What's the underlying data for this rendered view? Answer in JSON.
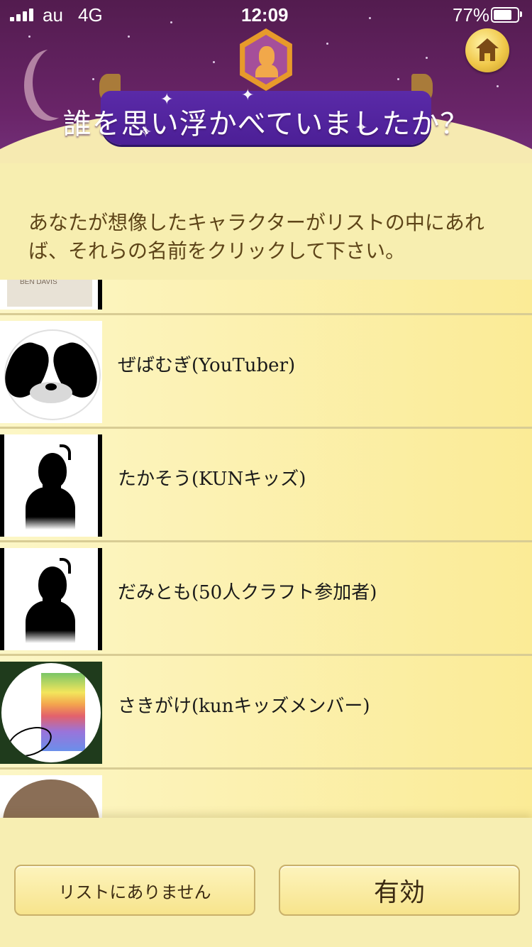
{
  "status_bar": {
    "carrier": "au",
    "network": "4G",
    "time": "12:09",
    "battery_percent": "77%",
    "battery_level": 0.77
  },
  "header": {
    "title": "誰を思い浮かべていましたか？",
    "home_icon": "home-icon",
    "badge_icon": "character-portrait-badge-icon"
  },
  "instructions": "あなたが想像したキャラクターがリストの中にあれば、それらの名前をクリックして下さい。",
  "list": {
    "items": [
      {
        "label": "",
        "thumbnail": "person-photo-shirt"
      },
      {
        "label": "ぜばむぎ(YouTuber)",
        "thumbnail": "panda-avatar"
      },
      {
        "label": "たかそう(KUNキッズ)",
        "thumbnail": "silhouette"
      },
      {
        "label": "だみとも(50人クラフト参加者)",
        "thumbnail": "silhouette"
      },
      {
        "label": "さきがけ(kunキッズメンバー)",
        "thumbnail": "rainbow-figure"
      },
      {
        "label": "",
        "thumbnail": "hair-drawing"
      }
    ]
  },
  "footer": {
    "not_in_list_label": "リストにありません",
    "valid_label": "有効"
  },
  "colors": {
    "header_purple": "#6a2569",
    "ribbon_purple": "#5a2aa8",
    "cream": "#f7eeb0",
    "text_brown": "#5d4418",
    "gold": "#f0c84a"
  }
}
